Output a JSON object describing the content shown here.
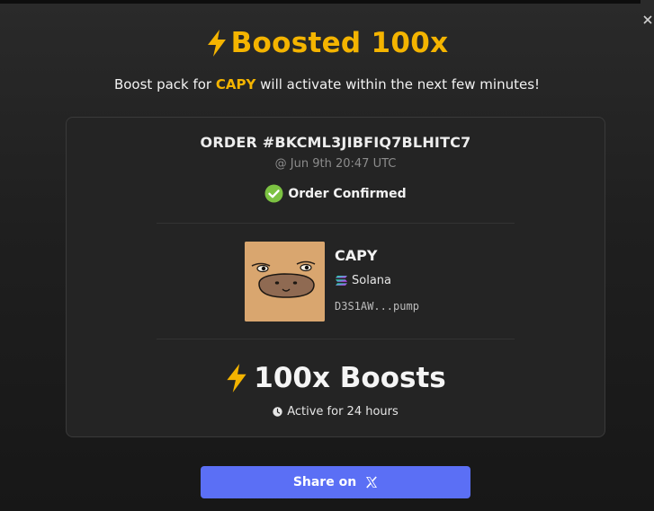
{
  "header": {
    "title": "Boosted 100x",
    "subtitle_prefix": "Boost pack for ",
    "subtitle_ticker": "CAPY",
    "subtitle_suffix": " will activate within the next few minutes!",
    "close_icon": "close-icon"
  },
  "order": {
    "id": "ORDER #BKCML3JIBFIQ7BLHITC7",
    "timestamp": "@ Jun 9th 20:47 UTC",
    "status": "Order Confirmed",
    "status_icon": "check-circle-icon"
  },
  "token": {
    "name": "CAPY",
    "chain": "Solana",
    "chain_icon": "solana-icon",
    "address": "D3S1AW...pump",
    "image": "capybara-face"
  },
  "boost": {
    "label": "100x Boosts",
    "duration": "Active for 24 hours",
    "icon": "lightning-bolt-icon"
  },
  "share": {
    "label": "Share on",
    "icon": "x-logo-icon"
  },
  "colors": {
    "accent": "#f4b400",
    "button": "#5b6ff5",
    "success": "#7cc242"
  }
}
